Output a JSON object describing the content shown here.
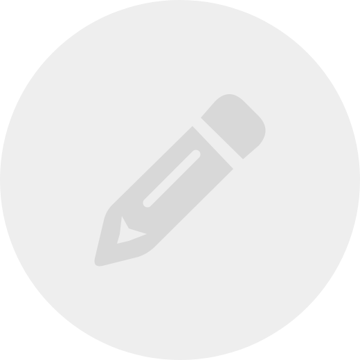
{
  "edit_button": {
    "icon": "pencil-icon",
    "background_color": "#eeeeee",
    "icon_color": "#d8d8d8"
  }
}
